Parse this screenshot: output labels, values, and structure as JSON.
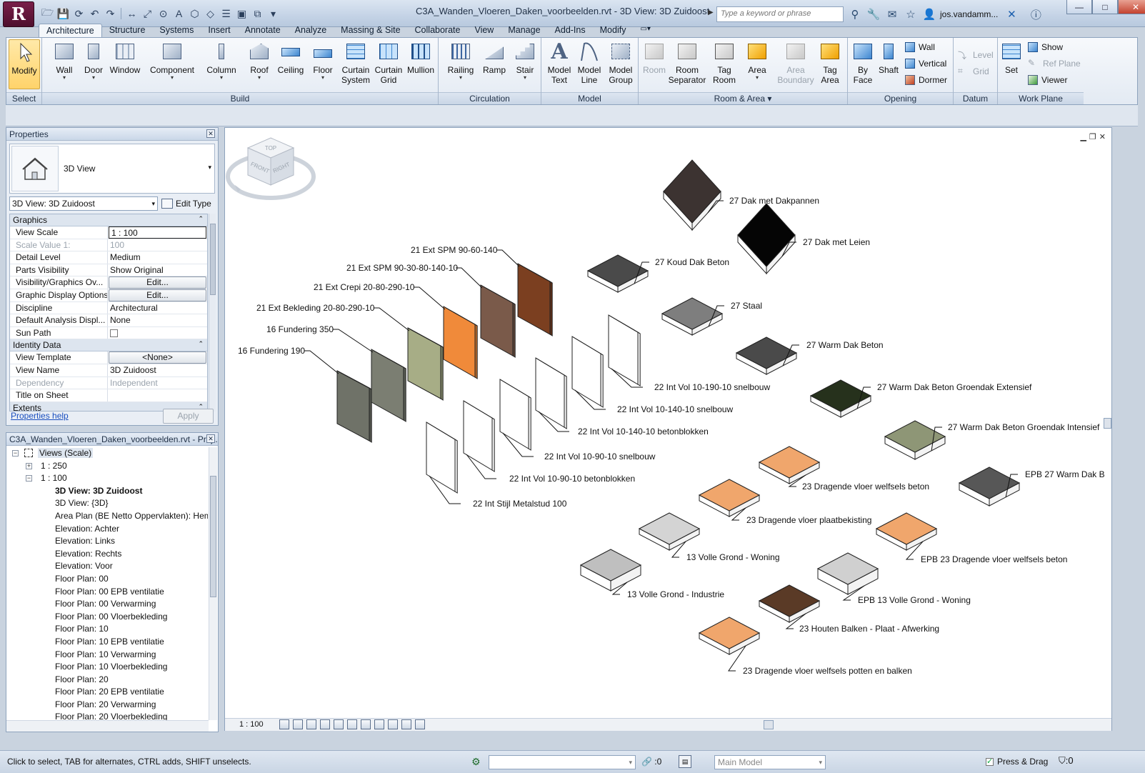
{
  "window": {
    "title": "C3A_Wanden_Vloeren_Daken_voorbeelden.rvt - 3D View: 3D Zuidoost",
    "search_placeholder": "Type a keyword or phrase",
    "user": "jos.vandamm...",
    "app_letter": "R"
  },
  "ribbon": {
    "tabs": [
      "Architecture",
      "Structure",
      "Systems",
      "Insert",
      "Annotate",
      "Analyze",
      "Massing & Site",
      "Collaborate",
      "View",
      "Manage",
      "Add-Ins",
      "Modify"
    ],
    "active_tab": "Architecture",
    "panels": {
      "select": "Select",
      "build": "Build",
      "circulation": "Circulation",
      "model": "Model",
      "room_area": "Room & Area",
      "opening": "Opening",
      "datum": "Datum",
      "work_plane": "Work Plane"
    },
    "tools": {
      "modify": "Modify",
      "wall": "Wall",
      "door": "Door",
      "window": "Window",
      "component": "Component",
      "column": "Column",
      "roof": "Roof",
      "ceiling": "Ceiling",
      "floor": "Floor",
      "curtain_system_1": "Curtain",
      "curtain_system_2": "System",
      "curtain_grid_1": "Curtain",
      "curtain_grid_2": "Grid",
      "mullion": "Mullion",
      "railing": "Railing",
      "ramp": "Ramp",
      "stair": "Stair",
      "model_text_1": "Model",
      "model_text_2": "Text",
      "model_line_1": "Model",
      "model_line_2": "Line",
      "model_group_1": "Model",
      "model_group_2": "Group",
      "room": "Room",
      "room_separator_1": "Room",
      "room_separator_2": "Separator",
      "tag_room_1": "Tag",
      "tag_room_2": "Room",
      "area": "Area",
      "area_boundary_1": "Area",
      "area_boundary_2": "Boundary",
      "tag_area_1": "Tag",
      "tag_area_2": "Area",
      "by_face_1": "By",
      "by_face_2": "Face",
      "shaft": "Shaft",
      "wall_opening": "Wall",
      "vertical": "Vertical",
      "dormer": "Dormer",
      "level": "Level",
      "grid": "Grid",
      "set": "Set",
      "show": "Show",
      "ref_plane": "Ref  Plane",
      "viewer": "Viewer"
    }
  },
  "properties": {
    "title": "Properties",
    "type_name": "3D View",
    "view_selector": "3D View: 3D Zuidoost",
    "edit_type": "Edit Type",
    "categories": {
      "graphics": "Graphics",
      "identity": "Identity Data",
      "extents": "Extents"
    },
    "rows": {
      "view_scale": {
        "name": "View Scale",
        "value": "1 : 100"
      },
      "scale_value": {
        "name": "Scale Value    1:",
        "value": "100"
      },
      "detail_level": {
        "name": "Detail Level",
        "value": "Medium"
      },
      "parts_visibility": {
        "name": "Parts Visibility",
        "value": "Show Original"
      },
      "vg": {
        "name": "Visibility/Graphics Ov...",
        "value": "Edit..."
      },
      "gdo": {
        "name": "Graphic Display Options",
        "value": "Edit..."
      },
      "discipline": {
        "name": "Discipline",
        "value": "Architectural"
      },
      "dad": {
        "name": "Default Analysis Displ...",
        "value": "None"
      },
      "sun_path": {
        "name": "Sun Path",
        "value": ""
      },
      "view_template": {
        "name": "View Template",
        "value": "<None>"
      },
      "view_name": {
        "name": "View Name",
        "value": "3D Zuidoost"
      },
      "dependency": {
        "name": "Dependency",
        "value": "Independent"
      },
      "title_on_sheet": {
        "name": "Title on Sheet",
        "value": ""
      }
    },
    "help": "Properties help",
    "apply": "Apply"
  },
  "browser": {
    "title": "C3A_Wanden_Vloeren_Daken_voorbeelden.rvt - Proj...",
    "nodes": [
      {
        "label": "Views (Scale)",
        "indent": 0,
        "exp": "−",
        "icon": true
      },
      {
        "label": "1 : 250",
        "indent": 1,
        "exp": "+"
      },
      {
        "label": "1 : 100",
        "indent": 1,
        "exp": "−"
      },
      {
        "label": "3D View: 3D Zuidoost",
        "indent": 2,
        "bold": true
      },
      {
        "label": "3D View: {3D}",
        "indent": 2
      },
      {
        "label": "Area Plan (BE Netto Oppervlakten): Hem",
        "indent": 2
      },
      {
        "label": "Elevation: Achter",
        "indent": 2
      },
      {
        "label": "Elevation: Links",
        "indent": 2
      },
      {
        "label": "Elevation: Rechts",
        "indent": 2
      },
      {
        "label": "Elevation: Voor",
        "indent": 2
      },
      {
        "label": "Floor Plan: 00",
        "indent": 2
      },
      {
        "label": "Floor Plan: 00 EPB ventilatie",
        "indent": 2
      },
      {
        "label": "Floor Plan: 00 Verwarming",
        "indent": 2
      },
      {
        "label": "Floor Plan: 00 Vloerbekleding",
        "indent": 2
      },
      {
        "label": "Floor Plan: 10",
        "indent": 2
      },
      {
        "label": "Floor Plan: 10 EPB ventilatie",
        "indent": 2
      },
      {
        "label": "Floor Plan: 10 Verwarming",
        "indent": 2
      },
      {
        "label": "Floor Plan: 10 Vloerbekleding",
        "indent": 2
      },
      {
        "label": "Floor Plan: 20",
        "indent": 2
      },
      {
        "label": "Floor Plan: 20 EPB ventilatie",
        "indent": 2
      },
      {
        "label": "Floor Plan: 20 Verwarming",
        "indent": 2
      },
      {
        "label": "Floor Plan: 20 Vloerbekleding",
        "indent": 2
      }
    ]
  },
  "canvas": {
    "view_scale": "1 : 100",
    "viewcube": {
      "top": "TOP",
      "front": "FRONT",
      "right": "RIGHT"
    },
    "walls": [
      {
        "label": "16 Fundering 190",
        "color": "#6f7268"
      },
      {
        "label": "16 Fundering 350",
        "color": "#7b7e72"
      },
      {
        "label": "21 Ext Bekleding 20-80-290-10",
        "color": "#a7ad86"
      },
      {
        "label": "21 Ext Crepi 20-80-290-10",
        "color": "#f08a3a"
      },
      {
        "label": "21 Ext SPM 90-30-80-140-10",
        "color": "#7a5a4a"
      },
      {
        "label": "21 Ext SPM 90-60-140",
        "color": "#7b3f20"
      },
      {
        "label": "22 Int Stijl Metalstud 100",
        "color": "#ffffff"
      },
      {
        "label": "22 Int Vol 10-90-10 betonblokken",
        "color": "#ffffff"
      },
      {
        "label": "22 Int Vol 10-90-10 snelbouw",
        "color": "#ffffff"
      },
      {
        "label": "22 Int Vol 10-140-10 betonblokken",
        "color": "#ffffff"
      },
      {
        "label": "22 Int Vol 10-140-10 snelbouw",
        "color": "#ffffff"
      },
      {
        "label": "22 Int Vol 10-190-10 snelbouw",
        "color": "#ffffff"
      }
    ],
    "slabs": [
      {
        "label": "27 Dak met Dakpannen",
        "color": "#3c3331"
      },
      {
        "label": "27 Dak met Leien",
        "color": "#050505"
      },
      {
        "label": "27 Koud Dak Beton",
        "color": "#4a4a4a"
      },
      {
        "label": "27 Staal",
        "color": "#7e7e7e"
      },
      {
        "label": "27 Warm Dak Beton",
        "color": "#4a4a4a"
      },
      {
        "label": "27 Warm Dak Beton Groendak Extensief",
        "color": "#26311c"
      },
      {
        "label": "27 Warm Dak Beton Groendak Intensief",
        "color": "#8e9676"
      },
      {
        "label": "EPB 27 Warm Dak B",
        "color": "#575757"
      },
      {
        "label": "23 Dragende vloer welfsels beton",
        "color": "#f0a66c"
      },
      {
        "label": "23 Dragende vloer plaatbekisting",
        "color": "#f0a66c"
      },
      {
        "label": "EPB 23 Dragende vloer welfsels beton",
        "color": "#f0a66c"
      },
      {
        "label": "13 Volle Grond - Woning",
        "color": "#d4d4d4"
      },
      {
        "label": "13 Volle Grond - Industrie",
        "color": "#bfbfbf"
      },
      {
        "label": "EPB 13 Volle Grond - Woning",
        "color": "#d0d0d0"
      },
      {
        "label": "23 Houten Balken - Plaat - Afwerking",
        "color": "#5a3a26"
      },
      {
        "label": "23 Dragende vloer welfsels potten en balken",
        "color": "#f0a66c"
      }
    ]
  },
  "statusbar": {
    "text": "Click to select, TAB for alternates, CTRL adds, SHIFT unselects.",
    "count": ":0",
    "design_option": "Main Model",
    "press_drag": "Press & Drag",
    "filter_count": ":0"
  }
}
